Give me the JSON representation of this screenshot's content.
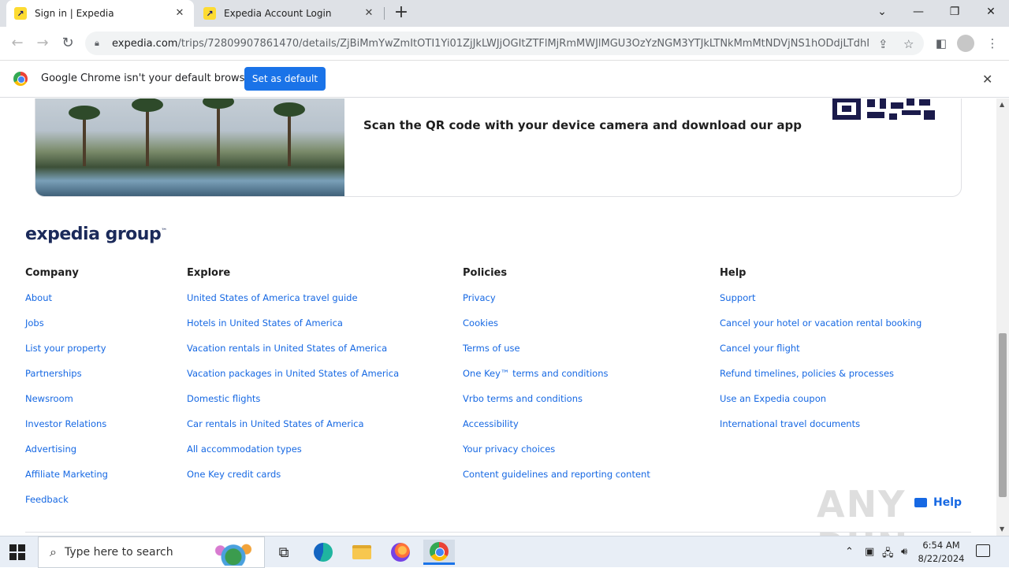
{
  "browser": {
    "tabs": [
      {
        "title": "Sign in | Expedia",
        "active": true
      },
      {
        "title": "Expedia Account Login",
        "active": false
      }
    ],
    "url_host": "expedia.com",
    "url_path": "/trips/72809907861470/details/ZjBiMmYwZmItOTI1Yi01ZjJkLWJjOGItZTFlMjRmMWJlMGU3OzYzNGM3YTJkLTNkMmMtNDVjNS1hODdjLTdhM...",
    "icons": {
      "back": "arrow-left-icon",
      "forward": "arrow-right-icon",
      "reload": "reload-icon",
      "share": "share-icon",
      "bookmark": "star-icon",
      "sidepanel": "side-panel-icon",
      "profile": "profile-icon",
      "menu": "kebab-menu-icon"
    }
  },
  "infobar": {
    "message": "Google Chrome isn't your default browser",
    "button": "Set as default"
  },
  "app_promo": {
    "text": "Scan the QR code with your device camera and download our app"
  },
  "footer": {
    "logo": "expedia group",
    "logo_mark": "™",
    "columns": [
      {
        "heading": "Company",
        "links": [
          "About",
          "Jobs",
          "List your property",
          "Partnerships",
          "Newsroom",
          "Investor Relations",
          "Advertising",
          "Affiliate Marketing",
          "Feedback"
        ]
      },
      {
        "heading": "Explore",
        "links": [
          "United States of America travel guide",
          "Hotels in United States of America",
          "Vacation rentals in United States of America",
          "Vacation packages in United States of America",
          "Domestic flights",
          "Car rentals in United States of America",
          "All accommodation types",
          "One Key credit cards"
        ]
      },
      {
        "heading": "Policies",
        "links": [
          "Privacy",
          "Cookies",
          "Terms of use",
          "One Key™ terms and conditions",
          "Vrbo terms and conditions",
          "Accessibility",
          "Your privacy choices",
          "Content guidelines and reporting content"
        ]
      },
      {
        "heading": "Help",
        "links": [
          "Support",
          "Cancel your hotel or vacation rental booking",
          "Cancel your flight",
          "Refund timelines, policies & processes",
          "Use an Expedia coupon",
          "International travel documents"
        ]
      }
    ],
    "help_button": "Help"
  },
  "watermark": "ANY RUN",
  "taskbar": {
    "search_placeholder": "Type here to search",
    "time": "6:54 AM",
    "date": "8/22/2024"
  },
  "colors": {
    "link": "#1668e3",
    "primary_button": "#1a73e8",
    "logo": "#1b2a5a"
  }
}
